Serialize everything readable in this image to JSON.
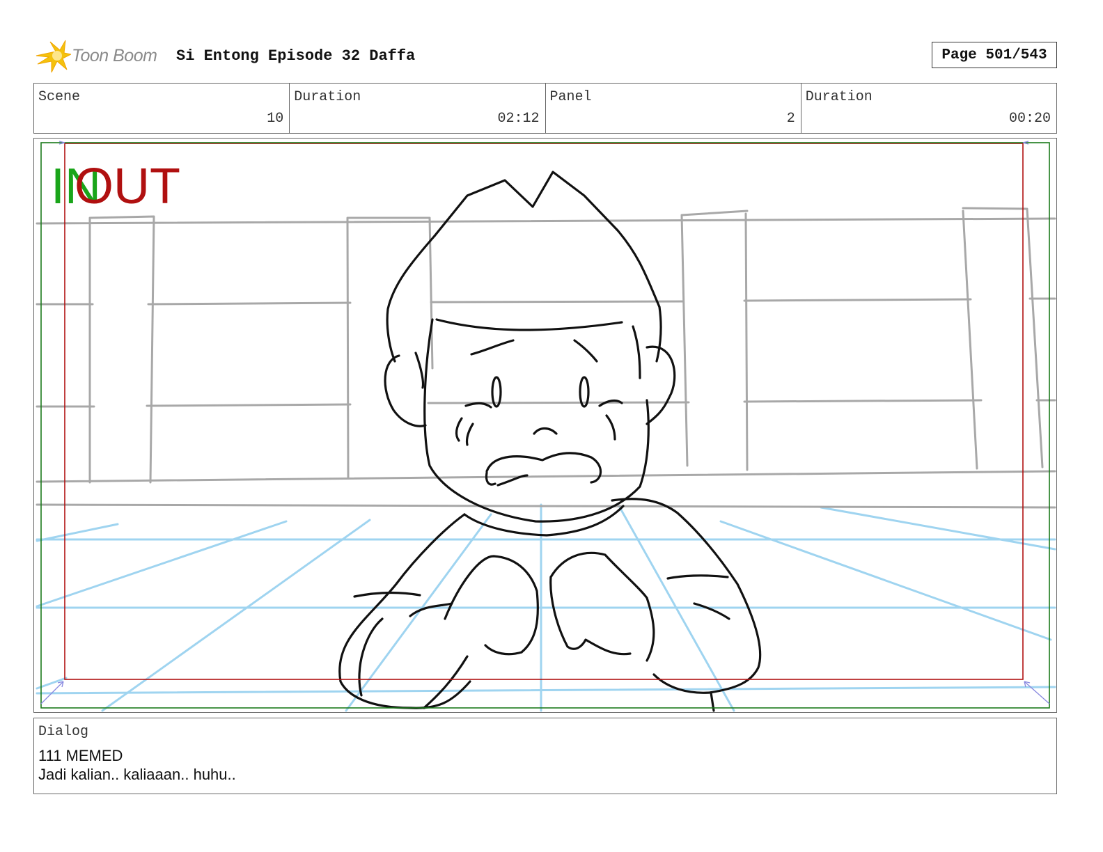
{
  "header": {
    "brand": "Toon Boom",
    "title": "Si Entong Episode 32 Daffa",
    "page_label": "Page 501/543",
    "logo_icon": "toon-boom-star-icon"
  },
  "info": {
    "scene_label": "Scene",
    "scene_value": "10",
    "scene_duration_label": "Duration",
    "scene_duration_value": "02:12",
    "panel_label": "Panel",
    "panel_value": "2",
    "panel_duration_label": "Duration",
    "panel_duration_value": "00:20"
  },
  "panel": {
    "in_label": "IN",
    "out_label": "OUT",
    "colors": {
      "in": "#1aa51a",
      "out": "#b01010",
      "sketch": "#111111",
      "background_lines": "#a8a8a8",
      "perspective_lines": "#9fd4f0"
    }
  },
  "dialog": {
    "label": "Dialog",
    "lines": [
      "111 MEMED",
      "Jadi kalian.. kaliaaan.. huhu.."
    ]
  }
}
